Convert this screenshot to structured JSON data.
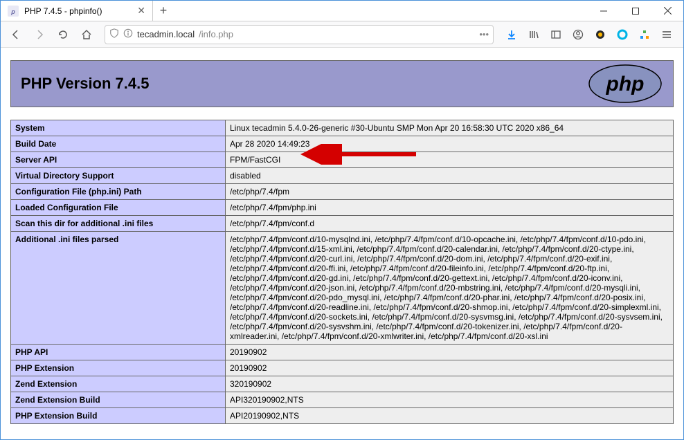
{
  "window": {
    "tab_title": "PHP 7.4.5 - phpinfo()",
    "url_host": "tecadmin.local",
    "url_path": "/info.php"
  },
  "page": {
    "header_title": "PHP Version 7.4.5",
    "rows": [
      {
        "key": "System",
        "val": "Linux tecadmin 5.4.0-26-generic #30-Ubuntu SMP Mon Apr 20 16:58:30 UTC 2020 x86_64"
      },
      {
        "key": "Build Date",
        "val": "Apr 28 2020 14:49:23"
      },
      {
        "key": "Server API",
        "val": "FPM/FastCGI"
      },
      {
        "key": "Virtual Directory Support",
        "val": "disabled"
      },
      {
        "key": "Configuration File (php.ini) Path",
        "val": "/etc/php/7.4/fpm"
      },
      {
        "key": "Loaded Configuration File",
        "val": "/etc/php/7.4/fpm/php.ini"
      },
      {
        "key": "Scan this dir for additional .ini files",
        "val": "/etc/php/7.4/fpm/conf.d"
      },
      {
        "key": "Additional .ini files parsed",
        "val": "/etc/php/7.4/fpm/conf.d/10-mysqlnd.ini, /etc/php/7.4/fpm/conf.d/10-opcache.ini, /etc/php/7.4/fpm/conf.d/10-pdo.ini, /etc/php/7.4/fpm/conf.d/15-xml.ini, /etc/php/7.4/fpm/conf.d/20-calendar.ini, /etc/php/7.4/fpm/conf.d/20-ctype.ini, /etc/php/7.4/fpm/conf.d/20-curl.ini, /etc/php/7.4/fpm/conf.d/20-dom.ini, /etc/php/7.4/fpm/conf.d/20-exif.ini, /etc/php/7.4/fpm/conf.d/20-ffi.ini, /etc/php/7.4/fpm/conf.d/20-fileinfo.ini, /etc/php/7.4/fpm/conf.d/20-ftp.ini, /etc/php/7.4/fpm/conf.d/20-gd.ini, /etc/php/7.4/fpm/conf.d/20-gettext.ini, /etc/php/7.4/fpm/conf.d/20-iconv.ini, /etc/php/7.4/fpm/conf.d/20-json.ini, /etc/php/7.4/fpm/conf.d/20-mbstring.ini, /etc/php/7.4/fpm/conf.d/20-mysqli.ini, /etc/php/7.4/fpm/conf.d/20-pdo_mysql.ini, /etc/php/7.4/fpm/conf.d/20-phar.ini, /etc/php/7.4/fpm/conf.d/20-posix.ini, /etc/php/7.4/fpm/conf.d/20-readline.ini, /etc/php/7.4/fpm/conf.d/20-shmop.ini, /etc/php/7.4/fpm/conf.d/20-simplexml.ini, /etc/php/7.4/fpm/conf.d/20-sockets.ini, /etc/php/7.4/fpm/conf.d/20-sysvmsg.ini, /etc/php/7.4/fpm/conf.d/20-sysvsem.ini, /etc/php/7.4/fpm/conf.d/20-sysvshm.ini, /etc/php/7.4/fpm/conf.d/20-tokenizer.ini, /etc/php/7.4/fpm/conf.d/20-xmlreader.ini, /etc/php/7.4/fpm/conf.d/20-xmlwriter.ini, /etc/php/7.4/fpm/conf.d/20-xsl.ini"
      },
      {
        "key": "PHP API",
        "val": "20190902"
      },
      {
        "key": "PHP Extension",
        "val": "20190902"
      },
      {
        "key": "Zend Extension",
        "val": "320190902"
      },
      {
        "key": "Zend Extension Build",
        "val": "API320190902,NTS"
      },
      {
        "key": "PHP Extension Build",
        "val": "API20190902,NTS"
      }
    ]
  }
}
